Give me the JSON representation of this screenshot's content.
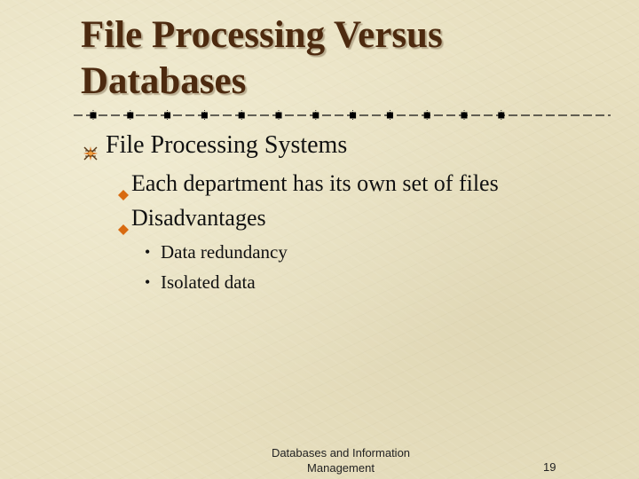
{
  "slide": {
    "title_line1": "File Processing Versus",
    "title_line2": "Databases",
    "colors": {
      "title": "#4d2a0f",
      "bullet_orange": "#d86a10",
      "background": "#e8e0c0"
    },
    "bullets": [
      {
        "level": 1,
        "icon": "star-burst-icon",
        "text": "File Processing Systems"
      },
      {
        "level": 2,
        "icon": "diamond-bullet-icon",
        "text": "Each department has its own set of files"
      },
      {
        "level": 2,
        "icon": "diamond-bullet-icon",
        "text": "Disadvantages"
      },
      {
        "level": 3,
        "icon": "dot-bullet",
        "glyph": "•",
        "text": "Data redundancy"
      },
      {
        "level": 3,
        "icon": "dot-bullet",
        "glyph": "•",
        "text": "Isolated data"
      }
    ],
    "footer": {
      "line1": "Databases and Information",
      "line2": "Management",
      "page_number": "19"
    }
  }
}
